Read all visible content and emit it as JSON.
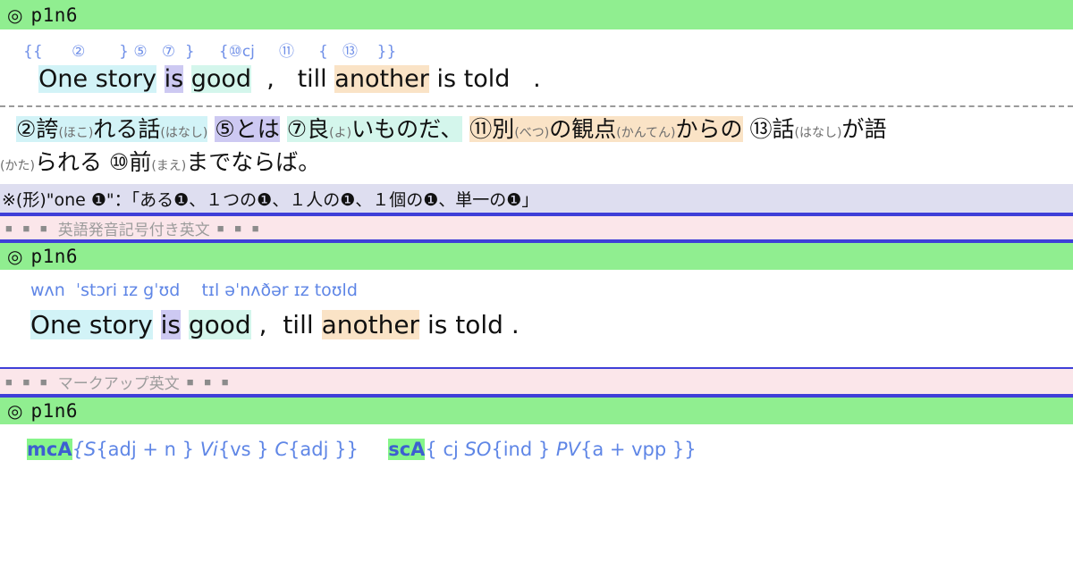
{
  "sections": {
    "header1": {
      "icon": "◎",
      "label": "p1n6"
    },
    "header2": {
      "icon": "◎",
      "label": "p1n6"
    },
    "header3": {
      "icon": "◎",
      "label": "p1n6"
    }
  },
  "annotated_english": {
    "tag_row": {
      "t1": "{{",
      "t2": "②",
      "t3": "}",
      "t4": "⑤",
      "t5": "⑦",
      "t6": "}",
      "t7": "{⑩cj",
      "t8": "⑪",
      "t9": "{",
      "t10": "⑬",
      "t11": "}}"
    },
    "sentence": {
      "s1": "One story",
      "s2": "is",
      "s3": "good",
      "s4": ",",
      "s5": "till",
      "s6": "another",
      "s7": "is told",
      "s8": "."
    }
  },
  "japanese": {
    "line1": {
      "a_num": "②",
      "a_kanji": "誇",
      "a_ruby": "(ほこ)",
      "a_tail": "れる",
      "b_kanji": "話",
      "b_ruby": "(はなし)",
      "c_num": "⑤",
      "c_text": "とは",
      "d_num": "⑦",
      "d_kanji": "良",
      "d_ruby": "(よ)",
      "d_tail": "いものだ、",
      "e_num": "⑪",
      "e_kanji": "別",
      "e_ruby": "(べつ)",
      "e_mid": "の",
      "e_kanji2": "観点",
      "e_ruby2": "(かんてん)",
      "e_tail": "からの",
      "f_num": "⑬",
      "f_kanji": "話",
      "f_ruby": "(はなし)",
      "f_tail": "が語"
    },
    "line2": {
      "g_ruby": "(かた)",
      "g_text": "られる",
      "h_num": "⑩",
      "h_kanji": "前",
      "h_ruby": "(まえ)",
      "h_tail": "までならば。"
    }
  },
  "note": {
    "text": "※(形)\"one ❶\"：「ある❶、１つの❶、１人の❶、１個の❶、単一の❶」"
  },
  "section_bars": {
    "phonetic": {
      "squares_left": "■ ■ ■",
      "title": "英語発音記号付き英文",
      "squares_right": "■ ■ ■"
    },
    "markup": {
      "squares_left": "■ ■ ■",
      "title": "マークアップ英文",
      "squares_right": "■ ■ ■"
    }
  },
  "phonetic": {
    "ipa": {
      "p1": "wʌn",
      "p2": "ˈstɔri",
      "p3": "ɪz",
      "p4": "gˈʊd",
      "p5": "tɪl",
      "p6": "əˈnʌðər",
      "p7": "ɪz toʊld"
    },
    "sentence": {
      "s1": "One story",
      "s2": "is",
      "s3": "good",
      "s4": ",",
      "s5": "till",
      "s6": "another",
      "s7": "is told",
      "s8": "."
    }
  },
  "markup": {
    "clause1": {
      "tag": "mcA",
      "body_open": "{",
      "s_label": "S",
      "s_body": "{adj + n }",
      "vi_label": "Vi",
      "vi_body": "{vs }",
      "c_label": "C",
      "c_body": "{adj }}"
    },
    "clause2": {
      "tag": "scA",
      "body_open": "{ cj ",
      "so_label": "SO",
      "so_body": "{ind }",
      "pv_label": "PV",
      "pv_body": "{a + vpp }}"
    }
  },
  "colors": {
    "title_bar": "#90ee90",
    "section_bar": "#fbe6ea",
    "note_bar": "#dedef0",
    "border_blue": "#3f3fd8",
    "hl_cyan": "#d2f3f7",
    "hl_lavender": "#cdc9f2",
    "hl_mint": "#d4f6ec",
    "hl_peach": "#fae3c6",
    "hl_green": "#86f58a",
    "tag_blue": "#6f8fe8"
  }
}
